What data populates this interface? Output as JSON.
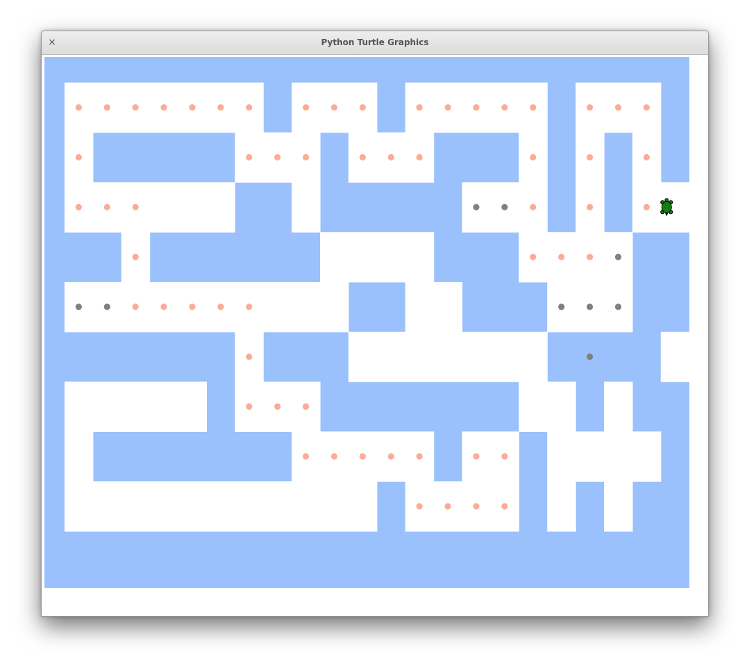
{
  "window": {
    "title": "Python Turtle Graphics",
    "close_glyph": "×"
  },
  "canvas": {
    "background": "#ffffff",
    "wall_color": "#9ac1fc",
    "path_color": "#ffffff",
    "pellet_color": "#fdab96",
    "visited_color": "#808080",
    "turtle_color": "#108010",
    "turtle_outline": "#000000",
    "cols": 22,
    "rows": 10,
    "grid": [
      "WWWWWWWWWWWWWWWWWWWWWWW",
      "W.......W...W.....W...W",
      "W.WWWWW...W...WWW.W.W.W",
      "W...  WW.WWWWW...W.W.T",
      "WWW.WWWWW    WW....WWW",
      "W.......  W  WW. ...WW",
      "WWWWWWWW.WWW      W.WW ",
      "W     W...WWWWWWW  W WW",
      "W WWWWWWW.....W..W   WW",
      "W           W ....W W WW",
      "WWWWWWWWWWWWWWWWWWWWWWW"
    ],
    "pellets_orange": [
      [
        1,
        1
      ],
      [
        2,
        1
      ],
      [
        3,
        1
      ],
      [
        4,
        1
      ],
      [
        5,
        1
      ],
      [
        6,
        1
      ],
      [
        7,
        1
      ],
      [
        9,
        1
      ],
      [
        10,
        1
      ],
      [
        11,
        1
      ],
      [
        13,
        1
      ],
      [
        14,
        1
      ],
      [
        15,
        1
      ],
      [
        16,
        1
      ],
      [
        17,
        1
      ],
      [
        19,
        1
      ],
      [
        20,
        1
      ],
      [
        21,
        1
      ],
      [
        1,
        2
      ],
      [
        7,
        2
      ],
      [
        8,
        2
      ],
      [
        9,
        2
      ],
      [
        11,
        2
      ],
      [
        12,
        2
      ],
      [
        13,
        2
      ],
      [
        17,
        2
      ],
      [
        19,
        2
      ],
      [
        21,
        2
      ],
      [
        1,
        3
      ],
      [
        2,
        3
      ],
      [
        3,
        3
      ],
      [
        17,
        3
      ],
      [
        19,
        3
      ],
      [
        21,
        3
      ],
      [
        3,
        4
      ],
      [
        17,
        4
      ],
      [
        18,
        4
      ],
      [
        19,
        4
      ],
      [
        3,
        5
      ],
      [
        4,
        5
      ],
      [
        5,
        5
      ],
      [
        6,
        5
      ],
      [
        7,
        5
      ],
      [
        7,
        6
      ],
      [
        7,
        7
      ],
      [
        8,
        7
      ],
      [
        9,
        7
      ],
      [
        9,
        8
      ],
      [
        10,
        8
      ],
      [
        11,
        8
      ],
      [
        12,
        8
      ],
      [
        13,
        8
      ],
      [
        15,
        8
      ],
      [
        16,
        8
      ],
      [
        13,
        9
      ],
      [
        14,
        9
      ],
      [
        15,
        9
      ],
      [
        16,
        9
      ]
    ],
    "pellets_visited": [
      [
        15,
        3
      ],
      [
        16,
        3
      ],
      [
        20,
        4
      ],
      [
        1,
        5
      ],
      [
        2,
        5
      ],
      [
        18,
        5
      ],
      [
        19,
        5
      ],
      [
        20,
        5
      ],
      [
        19,
        6
      ]
    ],
    "turtle_cell": [
      22,
      3
    ]
  }
}
